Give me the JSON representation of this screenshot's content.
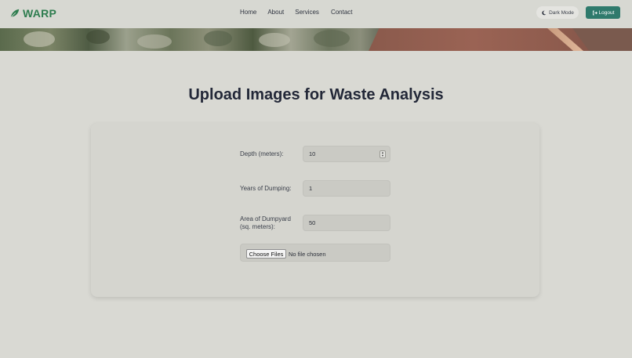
{
  "brand": {
    "name": "WARP",
    "icon": "leaf-icon",
    "color": "#2e7d4f"
  },
  "nav": {
    "items": [
      {
        "label": "Home"
      },
      {
        "label": "About"
      },
      {
        "label": "Services"
      },
      {
        "label": "Contact"
      }
    ]
  },
  "header_actions": {
    "dark_mode": {
      "label": "Dark Mode",
      "icon": "moon-icon"
    },
    "logout": {
      "label": "Logout",
      "icon": "logout-icon",
      "color": "#2f7a6c"
    }
  },
  "page": {
    "title": "Upload Images for Waste Analysis"
  },
  "form": {
    "depth": {
      "label": "Depth (meters):",
      "value": "10"
    },
    "years": {
      "label": "Years of Dumping:",
      "value": "1"
    },
    "area": {
      "label_line1": "Area of Dumpyard",
      "label_line2": "(sq. meters):",
      "value": "50"
    },
    "file": {
      "button_label": "Choose Files",
      "status": "No file chosen"
    }
  }
}
